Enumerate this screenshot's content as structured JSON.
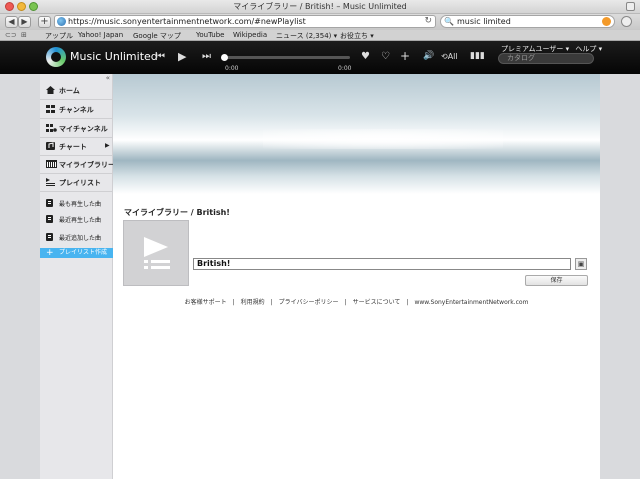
{
  "browser": {
    "window_title": "マイライブラリー / British! – Music Unlimited",
    "url": "https://music.sonyentertainmentnetwork.com/#newPlaylist",
    "search_value": "music limited",
    "bookmarks": [
      "アップル",
      "Yahoo! Japan",
      "Google マップ",
      "YouTube",
      "Wikipedia",
      "ニュース (2,354) ▾",
      "お役立ち ▾"
    ]
  },
  "app": {
    "brand": "Music Unlimited",
    "time_elapsed": "0:00",
    "time_total": "0:00",
    "progress": 0,
    "user_menu": "プレミアムユーザー ▾",
    "help_menu": "ヘルプ ▾",
    "catalog_placeholder": "カタログ",
    "repeat_label": "All"
  },
  "sidebar": {
    "items": [
      {
        "label": "ホーム",
        "icon": "home-icon"
      },
      {
        "label": "チャンネル",
        "icon": "channels-icon"
      },
      {
        "label": "マイチャンネル",
        "icon": "my-channels-icon"
      },
      {
        "label": "チャート",
        "icon": "chart-icon"
      },
      {
        "label": "マイライブラリー",
        "icon": "library-icon"
      },
      {
        "label": "プレイリスト",
        "icon": "playlist-icon"
      },
      {
        "label": "最も再生した曲",
        "icon": "list-icon"
      },
      {
        "label": "最近再生した曲",
        "icon": "list-icon"
      },
      {
        "label": "最近追加した曲",
        "icon": "list-icon"
      },
      {
        "label": "プレイリスト作成",
        "icon": "plus-icon"
      }
    ]
  },
  "main": {
    "breadcrumb": "マイライブラリー / British!",
    "playlist_name": "British!",
    "save_label": "保存"
  },
  "footer": {
    "links": [
      "お客様サポート",
      "|",
      "利用規約",
      "|",
      "プライバシーポリシー",
      "|",
      "サービスについて",
      "|",
      "www.SonyEntertainmentNetwork.com"
    ]
  },
  "colors": {
    "active_nav": "#48b4f0",
    "header_bg": "#0a0a0a"
  }
}
